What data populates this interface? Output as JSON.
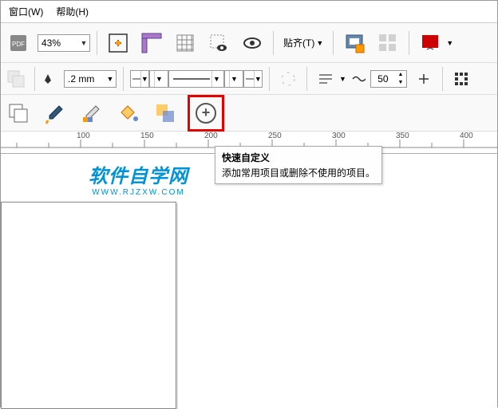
{
  "menu": {
    "window": "窗口(W)",
    "help": "帮助(H)"
  },
  "toolbar1": {
    "zoom_value": "43%",
    "align_label": "贴齐(T)"
  },
  "toolbar2": {
    "line_width": ".2 mm",
    "spinner_value": "50"
  },
  "tooltip": {
    "title": "快速自定义",
    "desc": "添加常用项目或删除不使用的项目。"
  },
  "ruler": {
    "marks": [
      "100",
      "150",
      "200",
      "250",
      "300",
      "350",
      "400"
    ]
  },
  "watermark": {
    "big": "软件自学网",
    "small": "WWW.RJZXW.COM"
  }
}
